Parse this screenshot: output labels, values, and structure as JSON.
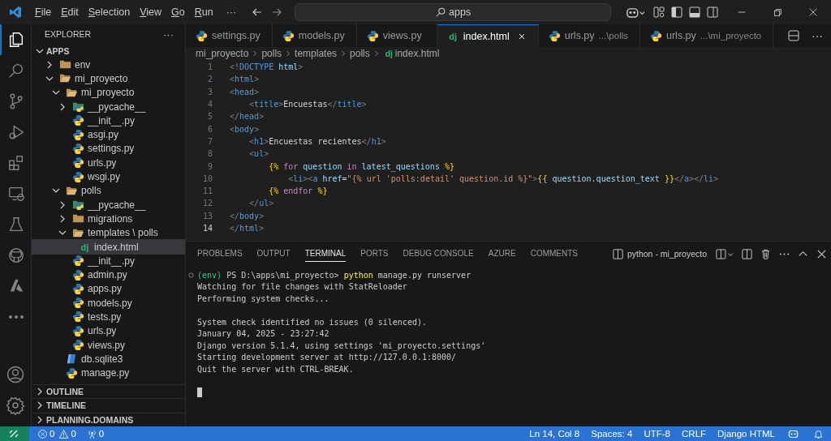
{
  "title_bar": {
    "menu": [
      "File",
      "Edit",
      "Selection",
      "View",
      "Go",
      "Run"
    ],
    "more": "···",
    "search": "apps"
  },
  "activity_bar": [
    {
      "kind": "explorer",
      "selected": true
    },
    {
      "kind": "search",
      "selected": false
    },
    {
      "kind": "source-control",
      "selected": false
    },
    {
      "kind": "debug",
      "selected": false
    },
    {
      "kind": "extensions",
      "selected": false
    },
    {
      "kind": "remote",
      "selected": false
    },
    {
      "kind": "testing",
      "selected": false
    },
    {
      "kind": "github",
      "selected": false
    },
    {
      "kind": "azure",
      "selected": false
    },
    {
      "kind": "more",
      "selected": false
    }
  ],
  "sidebar": {
    "title": "EXPLORER",
    "more": "···",
    "root": {
      "label": "APPS",
      "expanded": true
    },
    "tree": [
      {
        "label": "env",
        "kind": "folder",
        "expanded": false,
        "selected": false
      },
      {
        "label": "mi_proyecto",
        "kind": "folder",
        "expanded": true,
        "selected": false,
        "children": [
          {
            "label": "mi_proyecto",
            "kind": "folder",
            "expanded": true,
            "selected": false,
            "children": [
              {
                "label": "__pycache__",
                "kind": "pycache",
                "expanded": false,
                "selected": false
              },
              {
                "label": "__init__.py",
                "kind": "python",
                "selected": false
              },
              {
                "label": "asgi.py",
                "kind": "python",
                "selected": false
              },
              {
                "label": "settings.py",
                "kind": "python",
                "selected": false
              },
              {
                "label": "urls.py",
                "kind": "python",
                "selected": false
              },
              {
                "label": "wsgi.py",
                "kind": "python",
                "selected": false
              }
            ]
          },
          {
            "label": "polls",
            "kind": "folder",
            "expanded": true,
            "selected": false,
            "children": [
              {
                "label": "__pycache__",
                "kind": "pycache",
                "expanded": false,
                "selected": false
              },
              {
                "label": "migrations",
                "kind": "folder",
                "expanded": false,
                "selected": false
              },
              {
                "label": "templates \\ polls",
                "kind": "folder",
                "expanded": true,
                "selected": false,
                "children": [
                  {
                    "label": "index.html",
                    "kind": "django",
                    "badge": "dj",
                    "selected": true
                  }
                ]
              },
              {
                "label": "__init__.py",
                "kind": "python",
                "selected": false
              },
              {
                "label": "admin.py",
                "kind": "python",
                "selected": false
              },
              {
                "label": "apps.py",
                "kind": "python",
                "selected": false
              },
              {
                "label": "models.py",
                "kind": "python",
                "selected": false
              },
              {
                "label": "tests.py",
                "kind": "python",
                "selected": false
              },
              {
                "label": "urls.py",
                "kind": "python",
                "selected": false
              },
              {
                "label": "views.py",
                "kind": "python",
                "selected": false
              }
            ]
          },
          {
            "label": "db.sqlite3",
            "kind": "database",
            "selected": false
          },
          {
            "label": "manage.py",
            "kind": "python",
            "selected": false
          }
        ]
      }
    ],
    "sections": [
      {
        "label": "OUTLINE",
        "expanded": false
      },
      {
        "label": "TIMELINE",
        "expanded": false
      },
      {
        "label": "PLANNING.DOMAINS",
        "expanded": false
      }
    ]
  },
  "tabs": [
    {
      "label": "settings.py",
      "kind": "python",
      "selected": false
    },
    {
      "label": "models.py",
      "kind": "python",
      "selected": false
    },
    {
      "label": "views.py",
      "kind": "python",
      "selected": false
    },
    {
      "label": "index.html",
      "kind": "django",
      "badge": "dj",
      "selected": true
    },
    {
      "label": "urls.py",
      "description": "...\\polls",
      "kind": "python",
      "selected": false
    },
    {
      "label": "urls.py",
      "description": "...\\mi_proyecto",
      "kind": "python",
      "selected": false
    }
  ],
  "editor_more": "···",
  "breadcrumb": [
    {
      "label": "mi_proyecto"
    },
    {
      "label": "polls"
    },
    {
      "label": "templates"
    },
    {
      "label": "polls"
    },
    {
      "label": "index.html",
      "badge": "dj"
    }
  ],
  "code": [
    {
      "number": "1",
      "current": false,
      "tokens": [
        {
          "t": "<!",
          "kind": "punct"
        },
        {
          "t": "DOCTYPE",
          "kind": "tag"
        },
        {
          "t": " html",
          "kind": "attr"
        },
        {
          "t": ">",
          "kind": "punct"
        }
      ]
    },
    {
      "number": "2",
      "current": false,
      "tokens": [
        {
          "t": "<",
          "kind": "punct"
        },
        {
          "t": "html",
          "kind": "tag"
        },
        {
          "t": ">",
          "kind": "punct"
        }
      ]
    },
    {
      "number": "3",
      "current": false,
      "tokens": [
        {
          "t": "<",
          "kind": "punct"
        },
        {
          "t": "head",
          "kind": "tag"
        },
        {
          "t": ">",
          "kind": "punct"
        }
      ]
    },
    {
      "number": "4",
      "current": false,
      "tokens": [
        {
          "t": "    <",
          "kind": "punct"
        },
        {
          "t": "title",
          "kind": "tag"
        },
        {
          "t": ">",
          "kind": "punct"
        },
        {
          "t": "Encuestas",
          "kind": "text"
        },
        {
          "t": "</",
          "kind": "punct"
        },
        {
          "t": "title",
          "kind": "tag"
        },
        {
          "t": ">",
          "kind": "punct"
        }
      ]
    },
    {
      "number": "5",
      "current": false,
      "tokens": [
        {
          "t": "</",
          "kind": "punct"
        },
        {
          "t": "head",
          "kind": "tag"
        },
        {
          "t": ">",
          "kind": "punct"
        }
      ]
    },
    {
      "number": "6",
      "current": false,
      "tokens": [
        {
          "t": "<",
          "kind": "punct"
        },
        {
          "t": "body",
          "kind": "tag"
        },
        {
          "t": ">",
          "kind": "punct"
        }
      ]
    },
    {
      "number": "7",
      "current": false,
      "tokens": [
        {
          "t": "    <",
          "kind": "punct"
        },
        {
          "t": "h1",
          "kind": "tag"
        },
        {
          "t": ">",
          "kind": "punct"
        },
        {
          "t": "Encuestas recientes",
          "kind": "text"
        },
        {
          "t": "</",
          "kind": "punct"
        },
        {
          "t": "h1",
          "kind": "tag"
        },
        {
          "t": ">",
          "kind": "punct"
        }
      ]
    },
    {
      "number": "8",
      "current": false,
      "tokens": [
        {
          "t": "    <",
          "kind": "punct"
        },
        {
          "t": "ul",
          "kind": "tag"
        },
        {
          "t": ">",
          "kind": "punct"
        }
      ]
    },
    {
      "number": "9",
      "current": false,
      "tokens": [
        {
          "t": "        {%",
          "kind": "tmpl"
        },
        {
          "t": " for",
          "kind": "kw"
        },
        {
          "t": " question",
          "kind": "var"
        },
        {
          "t": " in",
          "kind": "kw"
        },
        {
          "t": " latest_questions ",
          "kind": "var"
        },
        {
          "t": "%}",
          "kind": "tmpl"
        }
      ]
    },
    {
      "number": "10",
      "current": false,
      "tokens": [
        {
          "t": "            <",
          "kind": "punct"
        },
        {
          "t": "li",
          "kind": "tag"
        },
        {
          "t": "><",
          "kind": "punct"
        },
        {
          "t": "a",
          "kind": "tag"
        },
        {
          "t": " href",
          "kind": "attr"
        },
        {
          "t": "=",
          "kind": "text"
        },
        {
          "t": "\"{% url 'polls:detail' question.id %}\"",
          "kind": "str"
        },
        {
          "t": ">",
          "kind": "punct"
        },
        {
          "t": "{{",
          "kind": "tmpl"
        },
        {
          "t": " question.question_text ",
          "kind": "var"
        },
        {
          "t": "}}",
          "kind": "tmpl"
        },
        {
          "t": "</",
          "kind": "punct"
        },
        {
          "t": "a",
          "kind": "tag"
        },
        {
          "t": "></",
          "kind": "punct"
        },
        {
          "t": "li",
          "kind": "tag"
        },
        {
          "t": ">",
          "kind": "punct"
        }
      ]
    },
    {
      "number": "11",
      "current": false,
      "tokens": [
        {
          "t": "        {%",
          "kind": "tmpl"
        },
        {
          "t": " endfor ",
          "kind": "kw"
        },
        {
          "t": "%}",
          "kind": "tmpl"
        }
      ]
    },
    {
      "number": "12",
      "current": false,
      "tokens": [
        {
          "t": "    </",
          "kind": "punct"
        },
        {
          "t": "ul",
          "kind": "tag"
        },
        {
          "t": ">",
          "kind": "punct"
        }
      ]
    },
    {
      "number": "13",
      "current": false,
      "tokens": [
        {
          "t": "</",
          "kind": "punct"
        },
        {
          "t": "body",
          "kind": "tag"
        },
        {
          "t": ">",
          "kind": "punct"
        }
      ]
    },
    {
      "number": "14",
      "current": true,
      "tokens": [
        {
          "t": "</",
          "kind": "punct"
        },
        {
          "t": "html",
          "kind": "tag"
        },
        {
          "t": ">",
          "kind": "punct"
        }
      ]
    }
  ],
  "panel": {
    "tabs": [
      {
        "label": "PROBLEMS",
        "selected": false
      },
      {
        "label": "OUTPUT",
        "selected": false
      },
      {
        "label": "TERMINAL",
        "selected": true
      },
      {
        "label": "PORTS",
        "selected": false
      },
      {
        "label": "DEBUG CONSOLE",
        "selected": false
      },
      {
        "label": "AZURE",
        "selected": false
      },
      {
        "label": "COMMENTS",
        "selected": false
      }
    ],
    "terminal_name": "python - mi_proyecto",
    "prompt": {
      "env": "(env)",
      "path": "PS D:\\apps\\mi_proyecto>",
      "command": "python",
      "args": "manage.py runserver"
    },
    "output_blocks": [
      [
        "Watching for file changes with StatReloader",
        "Performing system checks..."
      ],
      [
        "System check identified no issues (0 silenced).",
        "January 04, 2025 - 23:27:42",
        "Django version 5.1.4, using settings 'mi_proyecto.settings'",
        "Starting development server at http://127.0.0.1:8000/",
        "Quit the server with CTRL-BREAK."
      ]
    ]
  },
  "status_bar": {
    "errors": "0",
    "warnings": "0",
    "ports": "0",
    "right": [
      "Ln 14, Col 8",
      "Spaces: 4",
      "UTF-8",
      "CRLF",
      "Django HTML"
    ]
  }
}
